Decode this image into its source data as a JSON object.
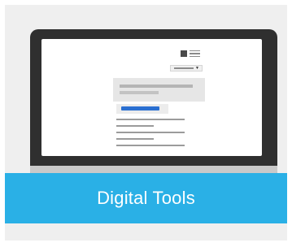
{
  "banner": {
    "title": "Digital Tools"
  },
  "colors": {
    "background": "#efefef",
    "banner": "#2ab0e6",
    "monitor": "#2f2f2f",
    "accent_button": "#2a6fd1"
  },
  "icons": {
    "monitor": "desktop-monitor-icon",
    "logo": "logo-icon",
    "dropdown_caret": "caret-down-icon"
  }
}
